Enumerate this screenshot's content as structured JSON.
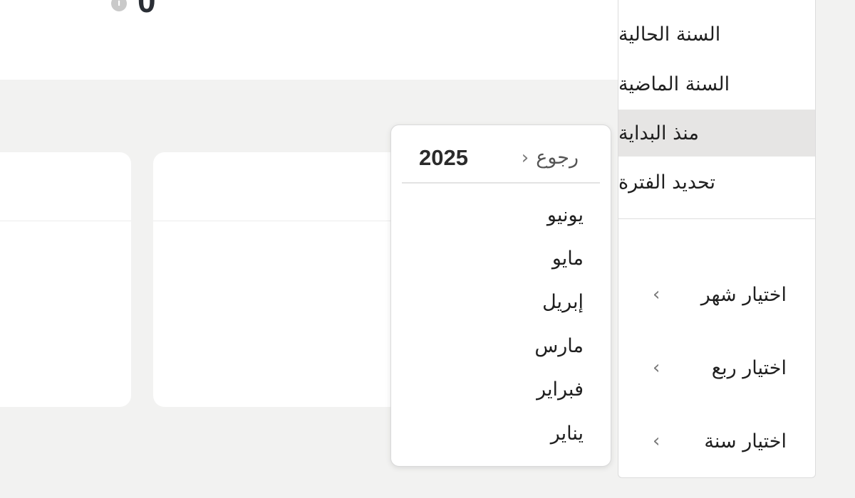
{
  "header": {
    "value": "0"
  },
  "sidebar": {
    "items": [
      {
        "label": "السنة الحالية",
        "active": false
      },
      {
        "label": "السنة الماضية",
        "active": false
      },
      {
        "label": "منذ البداية",
        "active": true
      },
      {
        "label": "تحديد الفترة",
        "active": false
      }
    ],
    "submenus": [
      {
        "label": "اختيار شهر",
        "icon": "chevron-left-icon"
      },
      {
        "label": "اختيار ربع",
        "icon": "chevron-left-icon"
      },
      {
        "label": "اختيار سنة",
        "icon": "chevron-left-icon"
      }
    ]
  },
  "month_picker": {
    "year": "2025",
    "back_label": "رجوع",
    "months": [
      "يونيو",
      "مايو",
      "إبريل",
      "مارس",
      "فبراير",
      "يناير"
    ]
  },
  "colors": {
    "background": "#f2f2f1",
    "active_item": "#e6e5e4",
    "value_text": "#2a2e35"
  }
}
